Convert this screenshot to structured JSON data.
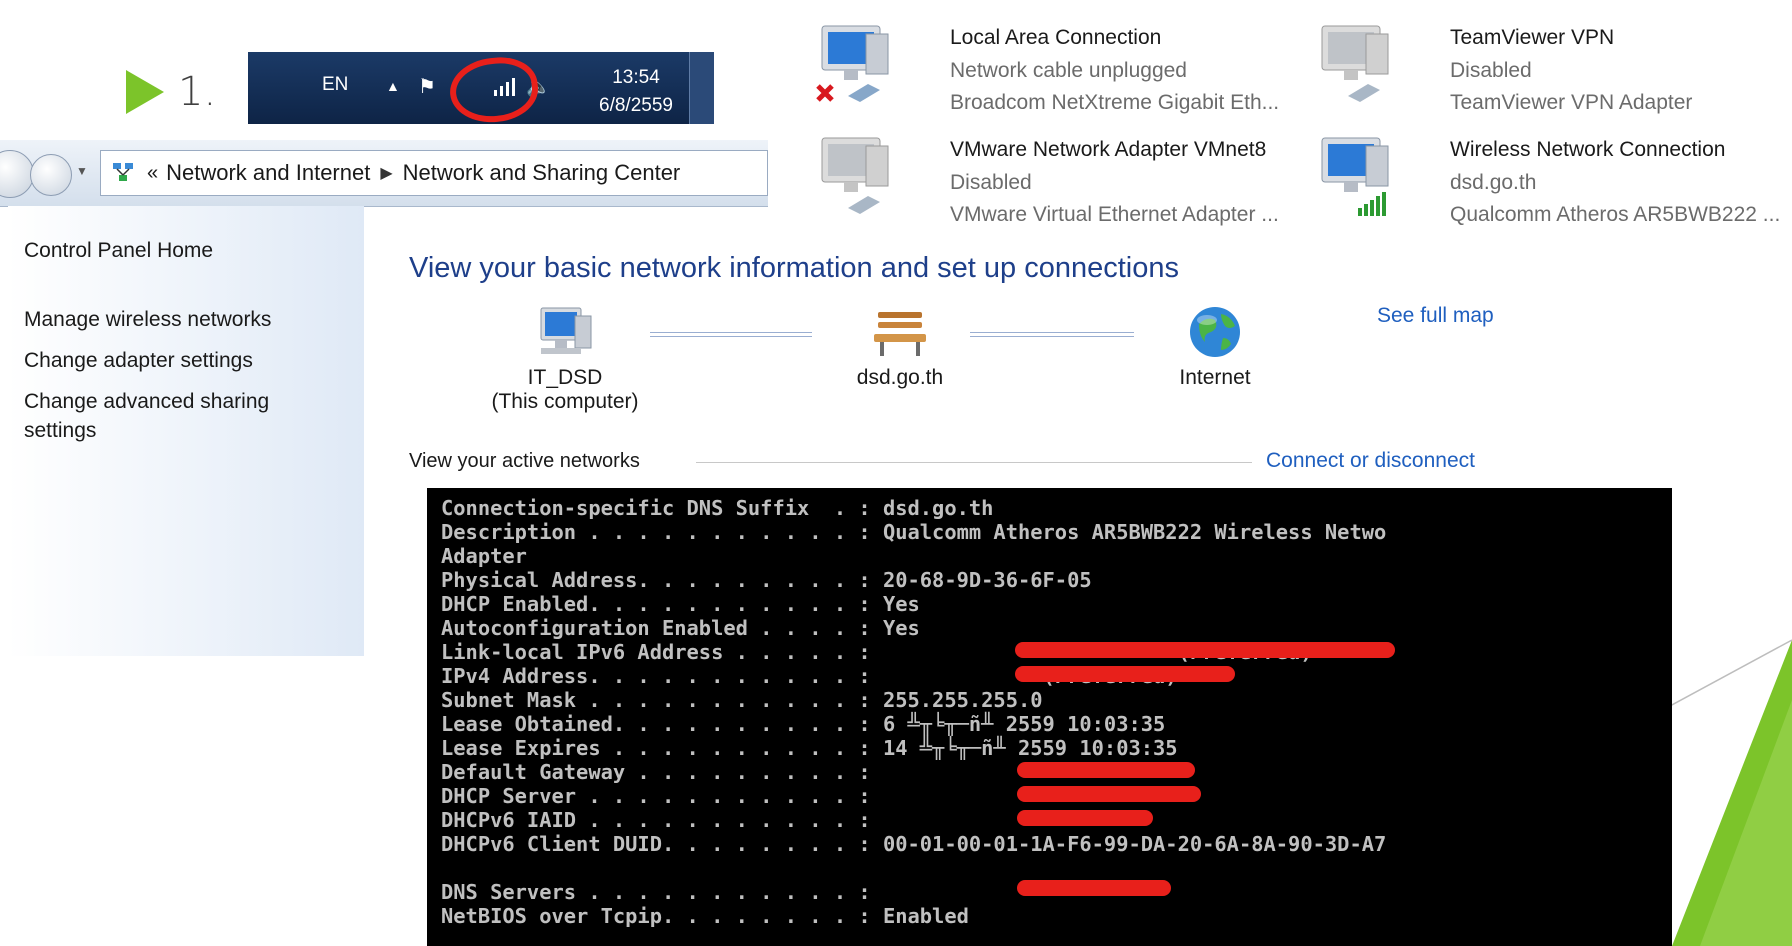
{
  "slide": {
    "step_number": "1.",
    "accent_color": "#7cc42a"
  },
  "taskbar": {
    "language": "EN",
    "time": "13:54",
    "date": "6/8/2559",
    "highlight_color": "#e8201b",
    "icons": [
      "show-hidden-icons-arrow-icon",
      "action-center-flag-icon",
      "wireless-signal-icon",
      "volume-icon"
    ]
  },
  "address_bar": {
    "overflow": "«",
    "crumb_1": "Network and Internet",
    "crumb_2": "Network and Sharing Center"
  },
  "left_pane": {
    "home": "Control Panel Home",
    "links": [
      "Manage wireless networks",
      "Change adapter settings",
      "Change advanced sharing",
      "settings"
    ]
  },
  "adapters": [
    {
      "name": "Local Area Connection",
      "status": "Network cable unplugged",
      "device": "Broadcom NetXtreme Gigabit Eth..."
    },
    {
      "name": "TeamViewer VPN",
      "status": "Disabled",
      "device": "TeamViewer VPN Adapter"
    },
    {
      "name": "VMware Network Adapter VMnet8",
      "status": "Disabled",
      "device": "VMware Virtual Ethernet Adapter ..."
    },
    {
      "name": "Wireless Network Connection",
      "status": "dsd.go.th",
      "device": "Qualcomm Atheros AR5BWB222 ..."
    }
  ],
  "main": {
    "title": "View your basic network information and set up connections",
    "see_full_map": "See full map",
    "node_computer": "IT_DSD",
    "node_computer_sub": "(This computer)",
    "node_network": "dsd.go.th",
    "node_internet": "Internet",
    "active_networks": "View your active networks",
    "connect_disconnect": "Connect or disconnect"
  },
  "console": {
    "lines": [
      "Connection-specific DNS Suffix  . : dsd.go.th",
      "Description . . . . . . . . . . . : Qualcomm Atheros AR5BWB222 Wireless Netwo",
      "Adapter",
      "Physical Address. . . . . . . . . : 20-68-9D-36-6F-05",
      "DHCP Enabled. . . . . . . . . . . : Yes",
      "Autoconfiguration Enabled . . . . : Yes",
      "Link-local IPv6 Address . . . . . :                         (Preferred)",
      "IPv4 Address. . . . . . . . . . . :              (Preferred)",
      "Subnet Mask . . . . . . . . . . . : 255.255.255.0",
      "Lease Obtained. . . . . . . . . . : 6 ╩╥╘╥─ñ╨ 2559 10:03:35",
      "Lease Expires . . . . . . . . . . : 14 ╩╥╘╥─ñ╨ 2559 10:03:35",
      "Default Gateway . . . . . . . . . : ",
      "DHCP Server . . . . . . . . . . . : ",
      "DHCPv6 IAID . . . . . . . . . . . : ",
      "DHCPv6 Client DUID. . . . . . . . : 00-01-00-01-1A-F6-99-DA-20-6A-8A-90-3D-A7",
      "",
      "DNS Servers . . . . . . . . . . . : ",
      "NetBIOS over Tcpip. . . . . . . . : Enabled"
    ]
  }
}
